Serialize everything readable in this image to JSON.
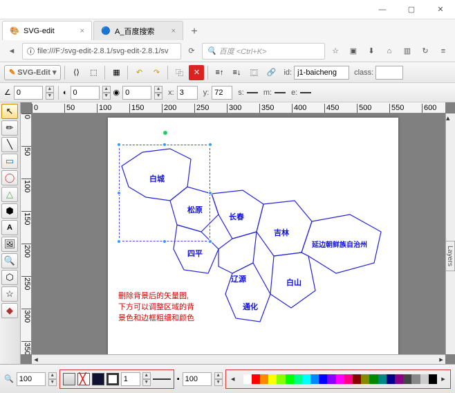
{
  "window": {
    "min": "—",
    "max": "▢",
    "close": "✕"
  },
  "tabs": [
    {
      "title": "SVG-edit",
      "icon": "🎨"
    },
    {
      "title": "A_百度搜索",
      "icon": "🔵"
    }
  ],
  "url": {
    "prefix": "ⓘ",
    "text": "file:///F:/svg-edit-2.8.1/svg-edit-2.8.1/sv"
  },
  "search": {
    "icon": "🔍",
    "placeholder": "百度 <Ctrl+K>"
  },
  "toolbar": {
    "svgEdit": "SVG-Edit ▾",
    "idLabel": "id:",
    "idValue": "j1-baicheng",
    "classLabel": "class:",
    "classValue": ""
  },
  "props": {
    "angle": "0",
    "opacity": "0",
    "blur": "0",
    "xLabel": "x:",
    "x": "3",
    "yLabel": "y:",
    "y": "72",
    "sLabel": "s:",
    "mLabel": "m:",
    "eLabel": "e:"
  },
  "regions": [
    "白城",
    "松原",
    "长春",
    "吉林",
    "延边朝鲜族自治州",
    "四平",
    "辽源",
    "白山",
    "通化"
  ],
  "note": {
    "l1": "删除背景后的矢量图,",
    "l2": "下方可以调整区域的背",
    "l3": "景色和边框粗细和颜色"
  },
  "layersLabel": "Layers",
  "bottom": {
    "zoom1": "100",
    "stroke": "1",
    "zoom2": "100"
  },
  "rulerH": [
    "0",
    "50",
    "100",
    "150",
    "200",
    "250",
    "300",
    "350",
    "400",
    "450",
    "500",
    "550",
    "600"
  ],
  "rulerV": [
    "0",
    "50",
    "100",
    "150",
    "200",
    "250",
    "300",
    "350"
  ],
  "palette": [
    "#ffffff",
    "#ff0000",
    "#ff8800",
    "#ffff00",
    "#88ff00",
    "#00ff00",
    "#00ff88",
    "#00ffff",
    "#0088ff",
    "#0000ff",
    "#8800ff",
    "#ff00ff",
    "#ff0088",
    "#880000",
    "#888800",
    "#008800",
    "#008888",
    "#000088",
    "#880088",
    "#444444",
    "#888888",
    "#cccccc",
    "#000000"
  ]
}
